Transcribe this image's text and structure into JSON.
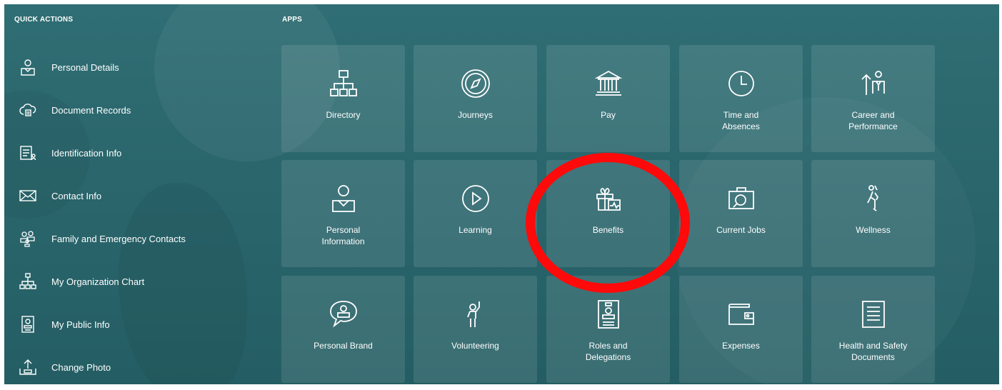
{
  "quick_actions": {
    "title": "QUICK ACTIONS",
    "items": [
      {
        "label": "Personal Details",
        "icon": "person-icon"
      },
      {
        "label": "Document Records",
        "icon": "cloud-document-icon"
      },
      {
        "label": "Identification Info",
        "icon": "id-card-icon"
      },
      {
        "label": "Contact Info",
        "icon": "envelope-icon"
      },
      {
        "label": "Family and Emergency Contacts",
        "icon": "family-icon"
      },
      {
        "label": "My Organization Chart",
        "icon": "org-chart-icon"
      },
      {
        "label": "My Public Info",
        "icon": "badge-icon"
      },
      {
        "label": "Change Photo",
        "icon": "upload-photo-icon"
      }
    ]
  },
  "apps": {
    "title": "APPS",
    "tiles": [
      {
        "label": "Directory",
        "icon": "org-chart-icon"
      },
      {
        "label": "Journeys",
        "icon": "compass-icon"
      },
      {
        "label": "Pay",
        "icon": "bank-icon"
      },
      {
        "label": "Time and\nAbsences",
        "icon": "clock-icon"
      },
      {
        "label": "Career and\nPerformance",
        "icon": "career-icon"
      },
      {
        "label": "Personal\nInformation",
        "icon": "person-icon"
      },
      {
        "label": "Learning",
        "icon": "play-icon"
      },
      {
        "label": "Benefits",
        "icon": "gift-health-icon"
      },
      {
        "label": "Current Jobs",
        "icon": "briefcase-search-icon"
      },
      {
        "label": "Wellness",
        "icon": "wellness-icon"
      },
      {
        "label": "Personal Brand",
        "icon": "speech-person-icon"
      },
      {
        "label": "Volunteering",
        "icon": "raised-hand-icon"
      },
      {
        "label": "Roles and\nDelegations",
        "icon": "badge-icon"
      },
      {
        "label": "Expenses",
        "icon": "wallet-icon"
      },
      {
        "label": "Health and Safety\nDocuments",
        "icon": "document-icon"
      }
    ]
  },
  "colors": {
    "background": "#2a666c",
    "tile": "rgba(255,255,255,0.10)",
    "annotation": "#ff0a0a"
  },
  "annotation": {
    "target": "Benefits",
    "shape": "red-circle"
  }
}
